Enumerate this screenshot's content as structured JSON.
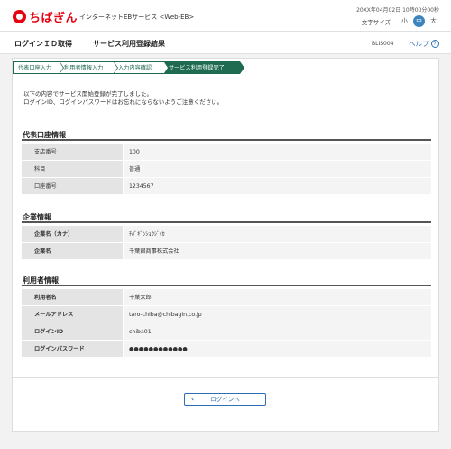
{
  "header": {
    "logo_text": "ちばぎん",
    "service_name": "インターネットEBサービス <Web-EB>",
    "datetime": "20XX年04月02日 10時00分00秒",
    "font_size_label": "文字サイズ",
    "font_sizes": [
      "小",
      "中",
      "大"
    ],
    "brand_color": "#e60012"
  },
  "titlebar": {
    "title": "ログインＩＤ取得",
    "subtitle": "サービス利用登録結果",
    "screen_id": "BLIS004",
    "help_label": "ヘルプ",
    "help_icon": "?"
  },
  "steps": [
    "代表口座入力",
    "利用者情報入力",
    "入力内容確認",
    "サービス利用登録完了"
  ],
  "message": {
    "line1": "以下の内容でサービス開始登録が完了しました。",
    "line2": "ログインID、ログインパスワードはお忘れにならないようご注意ください。"
  },
  "sections": {
    "account": {
      "title": "代表口座情報",
      "rows": [
        {
          "label": "支店番号",
          "value": "100"
        },
        {
          "label": "科目",
          "value": "普通"
        },
        {
          "label": "口座番号",
          "value": "1234567"
        }
      ]
    },
    "company": {
      "title": "企業情報",
      "rows": [
        {
          "label": "企業名（カナ）",
          "value": "ﾁﾊﾞｷﾞﾝｼｮｳｼﾞ(ｶ"
        },
        {
          "label": "企業名",
          "value": "千葉銀商事株式会社"
        }
      ]
    },
    "user": {
      "title": "利用者情報",
      "rows": [
        {
          "label": "利用者名",
          "value": "千葉太郎"
        },
        {
          "label": "メールアドレス",
          "value": "taro-chiba@chibagin.co.jp"
        },
        {
          "label": "ログインID",
          "value": "chiba01"
        },
        {
          "label": "ログインパスワード",
          "value": "●●●●●●●●●●●●"
        }
      ]
    }
  },
  "login_button": {
    "label": "ログインへ",
    "icon": "‹"
  },
  "colors": {
    "step_active": "#1e6b52",
    "link": "#2d6fb6"
  }
}
